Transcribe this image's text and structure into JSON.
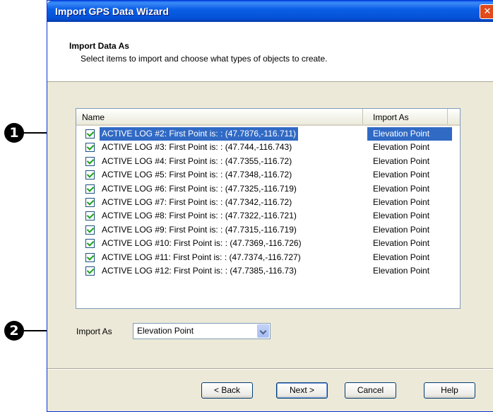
{
  "window": {
    "title": "Import GPS Data Wizard",
    "close_glyph": "✕"
  },
  "header": {
    "title": "Import Data As",
    "subtitle": "Select items to import and choose what types of objects to create."
  },
  "list": {
    "columns": [
      "Name",
      "Import As"
    ],
    "rows": [
      {
        "name": "ACTIVE LOG #2: First Point is: : (47.7876,-116.711)",
        "import_as": "Elevation Point",
        "checked": true,
        "selected": true
      },
      {
        "name": "ACTIVE LOG #3: First Point is: : (47.744,-116.743)",
        "import_as": "Elevation Point",
        "checked": true,
        "selected": false
      },
      {
        "name": "ACTIVE LOG #4: First Point is: : (47.7355,-116.72)",
        "import_as": "Elevation Point",
        "checked": true,
        "selected": false
      },
      {
        "name": "ACTIVE LOG #5: First Point is: : (47.7348,-116.72)",
        "import_as": "Elevation Point",
        "checked": true,
        "selected": false
      },
      {
        "name": "ACTIVE LOG #6: First Point is: : (47.7325,-116.719)",
        "import_as": "Elevation Point",
        "checked": true,
        "selected": false
      },
      {
        "name": "ACTIVE LOG #7: First Point is: : (47.7342,-116.72)",
        "import_as": "Elevation Point",
        "checked": true,
        "selected": false
      },
      {
        "name": "ACTIVE LOG #8: First Point is: : (47.7322,-116.721)",
        "import_as": "Elevation Point",
        "checked": true,
        "selected": false
      },
      {
        "name": "ACTIVE LOG #9: First Point is: : (47.7315,-116.719)",
        "import_as": "Elevation Point",
        "checked": true,
        "selected": false
      },
      {
        "name": "ACTIVE LOG #10: First Point is: : (47.7369,-116.726)",
        "import_as": "Elevation Point",
        "checked": true,
        "selected": false
      },
      {
        "name": "ACTIVE LOG #11: First Point is: : (47.7374,-116.727)",
        "import_as": "Elevation Point",
        "checked": true,
        "selected": false
      },
      {
        "name": "ACTIVE LOG #12: First Point is: : (47.7385,-116.73)",
        "import_as": "Elevation Point",
        "checked": true,
        "selected": false
      }
    ]
  },
  "import_as": {
    "label": "Import As",
    "value": "Elevation Point"
  },
  "buttons": {
    "back": "< Back",
    "next": "Next >",
    "cancel": "Cancel",
    "help": "Help"
  },
  "callouts": {
    "one": "1",
    "two": "2"
  },
  "colors": {
    "selection": "#316ac5",
    "titlebar": "#0a5fe6",
    "dialog_bg": "#ece9d8"
  }
}
